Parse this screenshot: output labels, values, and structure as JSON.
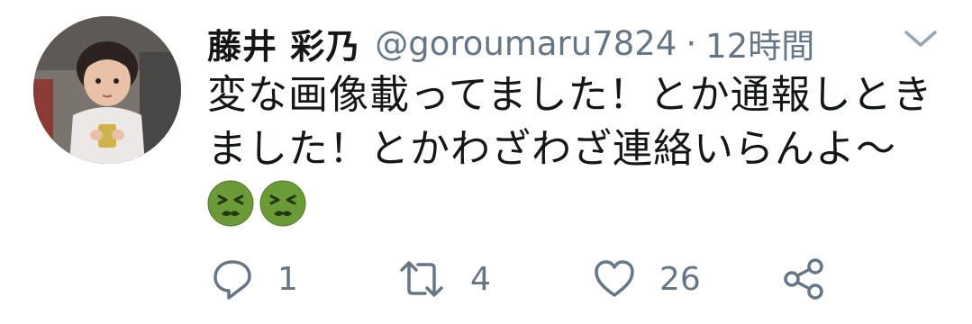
{
  "tweet": {
    "author": {
      "display_name": "藤井 彩乃",
      "handle": "@goroumaru7824",
      "avatar": "child-photo-avatar"
    },
    "separator": "·",
    "time": "12時間",
    "menu_icon": "chevron-down-icon",
    "text": "変な画像載ってました！とか通報しときました！とかわざわざ連絡いらんよ〜",
    "emojis": [
      "nauseated-face-icon",
      "nauseated-face-icon"
    ],
    "actions": {
      "reply": {
        "icon": "reply-icon",
        "count": "1"
      },
      "retweet": {
        "icon": "retweet-icon",
        "count": "4"
      },
      "like": {
        "icon": "heart-icon",
        "count": "26"
      },
      "share": {
        "icon": "share-icon"
      }
    }
  },
  "colors": {
    "text": "#14171a",
    "secondary": "#657786",
    "emoji_green": "#6b9b37"
  }
}
